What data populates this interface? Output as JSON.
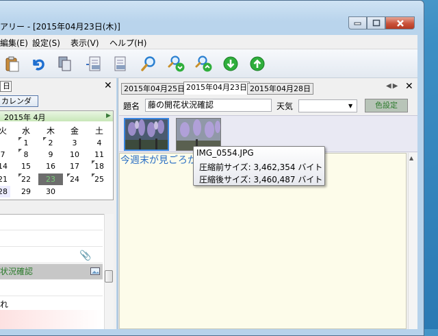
{
  "window": {
    "title": "アリー - [2015年04月23日(木)]"
  },
  "menubar": {
    "items": [
      "編集(E)",
      "設定(S)",
      "表示(V)",
      "ヘルプ(H)"
    ]
  },
  "toolbar": {
    "icons": [
      "paste-icon",
      "undo-icon",
      "copy-icon",
      "import-icon",
      "export-icon",
      "search-icon",
      "search-down-icon",
      "search-up-icon",
      "next-down-icon",
      "next-up-icon"
    ]
  },
  "left": {
    "tab_label": "日",
    "calendar_button": "カレンダ",
    "calendar": {
      "month": "2015年 4月",
      "weekdays": [
        "火",
        "水",
        "木",
        "金",
        "土"
      ],
      "rows": [
        [
          "",
          "1",
          "2",
          "3",
          "4"
        ],
        [
          "7",
          "8",
          "9",
          "10",
          "11"
        ],
        [
          "14",
          "15",
          "16",
          "17",
          "18"
        ],
        [
          "21",
          "22",
          "23",
          "24",
          "25"
        ],
        [
          "28",
          "29",
          "30",
          "",
          ""
        ]
      ],
      "partial_left": [
        "",
        "",
        "",
        "",
        "28"
      ],
      "today": "23"
    },
    "list_items": [
      "",
      "",
      "",
      "状況確認",
      "",
      "れ",
      ""
    ]
  },
  "right": {
    "tabs": [
      "2015年04月25日",
      "2015年04月23日",
      "2015年04月28日"
    ],
    "active_tab": "2015年04月23日",
    "subject_label": "題名",
    "subject_value": "藤の開花状況確認",
    "weather_label": "天気",
    "weather_value": "",
    "color_button": "色設定",
    "editor_text": "今週末が見ごろかな"
  },
  "tooltip": {
    "filename": "IMG_0554.JPG",
    "before": "圧縮前サイズ: 3,462,354 バイト",
    "after": "圧縮後サイズ: 3,460,487 バイト"
  },
  "colors": {
    "accent": "#2a6fc4",
    "today_bg": "#6d6d6d",
    "green_text": "#2a7a2a"
  }
}
